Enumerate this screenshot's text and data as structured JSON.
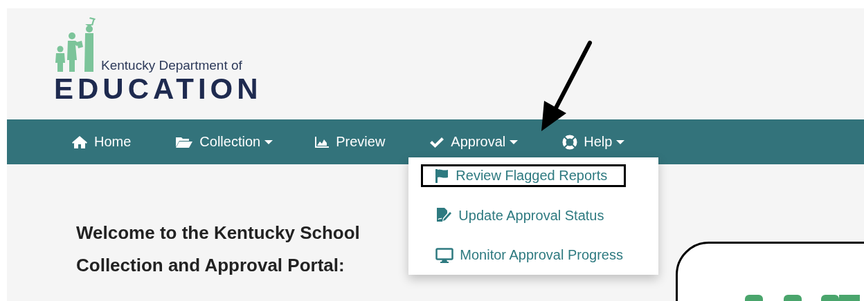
{
  "logo": {
    "line_1": "Kentucky Department of",
    "line_2": "EDUCATION"
  },
  "nav": [
    {
      "label": "Home",
      "dropdown": false
    },
    {
      "label": "Collection",
      "dropdown": true
    },
    {
      "label": "Preview",
      "dropdown": false
    },
    {
      "label": "Approval",
      "dropdown": true,
      "menu": [
        {
          "label": "Review Flagged Reports",
          "highlighted": true
        },
        {
          "label": "Update Approval Status",
          "highlighted": false
        },
        {
          "label": "Monitor Approval Progress",
          "highlighted": false
        }
      ]
    },
    {
      "label": "Help",
      "dropdown": true
    }
  ],
  "welcome": [
    "Welcome to the Kentucky School",
    "Collection and Approval Portal:"
  ]
}
